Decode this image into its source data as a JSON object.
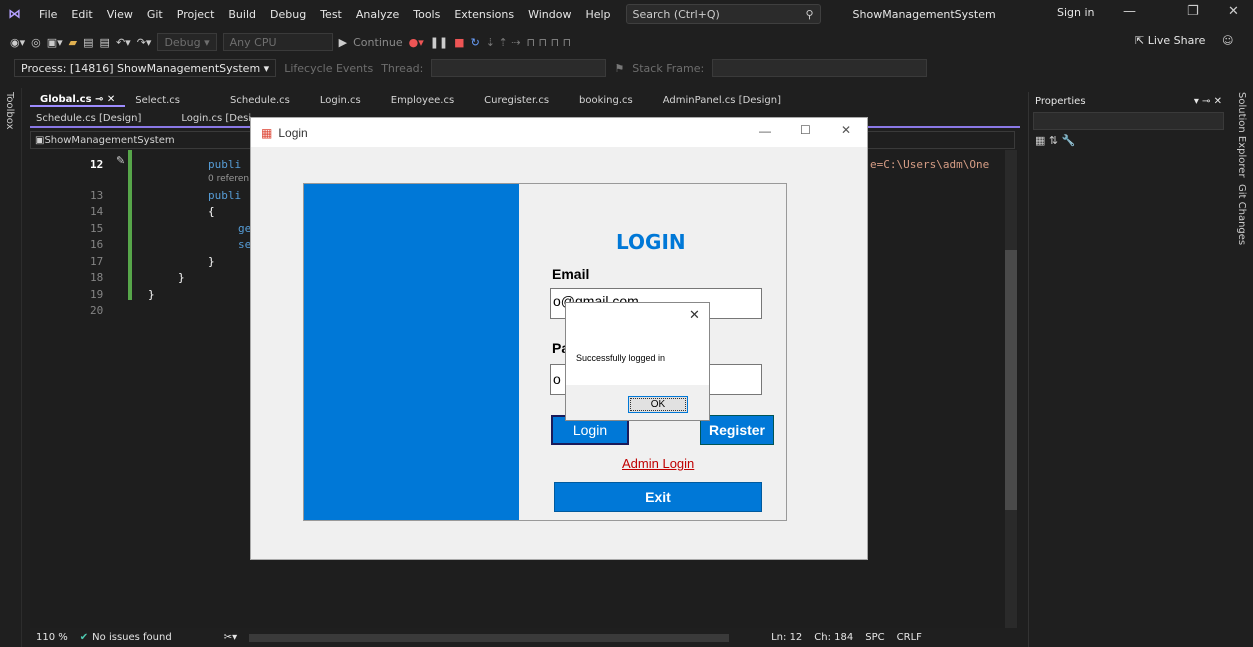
{
  "menubar": {
    "items": [
      "File",
      "Edit",
      "View",
      "Git",
      "Project",
      "Build",
      "Debug",
      "Test",
      "Analyze",
      "Tools",
      "Extensions",
      "Window",
      "Help"
    ],
    "search": "Search (Ctrl+Q)",
    "solution_title": "ShowManagementSystem",
    "sign_in": "Sign in"
  },
  "toolbar": {
    "config": "Debug",
    "platform": "Any CPU",
    "continue": "Continue",
    "live_share": "Live Share"
  },
  "debugbar": {
    "process": "Process: [14816] ShowManagementSystem",
    "lifecycle": "Lifecycle Events",
    "thread": "Thread:",
    "stack_frame": "Stack Frame:"
  },
  "side": {
    "toolbox": "Toolbox",
    "solution_explorer": "Solution Explorer",
    "git_changes": "Git Changes"
  },
  "tabs_row1": [
    "Global.cs",
    "Select.cs",
    "Schedule.cs",
    "Login.cs",
    "Employee.cs",
    "Curegister.cs",
    "booking.cs",
    "AdminPanel.cs [Design]"
  ],
  "tabs_row2": [
    "Schedule.cs [Design]",
    "Login.cs [Desi"
  ],
  "navbar": {
    "project": "ShowManagementSystem"
  },
  "editor": {
    "line_numbers": [
      "12",
      "13",
      "14",
      "15",
      "16",
      "17",
      "18",
      "19",
      "20"
    ],
    "code_lines": [
      "publi",
      "0 referen",
      "publi",
      "{",
      "ge",
      "se",
      "}",
      "}",
      "}"
    ],
    "right_snippet": "e=C:\\Users\\adm\\One"
  },
  "statusbar": {
    "zoom": "110 %",
    "issues": "No issues found",
    "ln": "Ln: 12",
    "ch": "Ch: 184",
    "spc": "SPC",
    "crlf": "CRLF"
  },
  "properties": {
    "title": "Properties"
  },
  "login_window": {
    "title": "Login",
    "heading": "LOGIN",
    "email_label": "Email",
    "email_value": "o@gmail.com",
    "password_label": "Pa",
    "password_value": "o",
    "login_button": "Login",
    "register_button": "Register",
    "admin_login": "Admin Login",
    "exit_button": "Exit"
  },
  "messagebox": {
    "text": "Successfully logged in",
    "ok": "OK"
  },
  "colors": {
    "accent_blue": "#0078d7",
    "vs_purple": "#8a78e6",
    "admin_link": "#c00000",
    "login_heading": "#0078d7"
  }
}
